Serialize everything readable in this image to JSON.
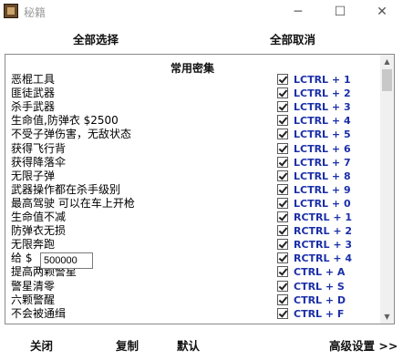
{
  "window": {
    "title": "秘籍",
    "minimize_glyph": "─",
    "maximize_glyph": "☐",
    "close_glyph": "✕",
    "icon": "app-icon"
  },
  "top_buttons": {
    "select_all": "全部选择",
    "deselect_all": "全部取消"
  },
  "section_title": "常用密集",
  "cheats": [
    {
      "label": "恶棍工具",
      "hotkey": "LCTRL + 1",
      "checked": true
    },
    {
      "label": "匪徒武器",
      "hotkey": "LCTRL + 2",
      "checked": true
    },
    {
      "label": "杀手武器",
      "hotkey": "LCTRL + 3",
      "checked": true
    },
    {
      "label": "生命值,防弹衣 $2500",
      "hotkey": "LCTRL + 4",
      "checked": true
    },
    {
      "label": "不受子弹伤害，无敌状态",
      "hotkey": "LCTRL + 5",
      "checked": true
    },
    {
      "label": "获得飞行背",
      "hotkey": "LCTRL + 6",
      "checked": true
    },
    {
      "label": "获得降落伞",
      "hotkey": "LCTRL + 7",
      "checked": true
    },
    {
      "label": "无限子弹",
      "hotkey": "LCTRL + 8",
      "checked": true
    },
    {
      "label": "武器操作都在杀手级别",
      "hotkey": "LCTRL + 9",
      "checked": true
    },
    {
      "label": "最高驾驶 可以在车上开枪",
      "hotkey": "LCTRL + 0",
      "checked": true
    },
    {
      "label": "生命值不减",
      "hotkey": "RCTRL + 1",
      "checked": true
    },
    {
      "label": "防弹衣无损",
      "hotkey": "RCTRL + 2",
      "checked": true
    },
    {
      "label": "无限奔跑",
      "hotkey": "RCTRL + 3",
      "checked": true
    },
    {
      "label": "给 $",
      "hotkey": "RCTRL + 4",
      "checked": true
    },
    {
      "label": "提高两颗警星",
      "hotkey": "CTRL + A",
      "checked": true
    },
    {
      "label": "警星清零",
      "hotkey": "CTRL + S",
      "checked": true
    },
    {
      "label": "六颗警醒",
      "hotkey": "CTRL + D",
      "checked": true
    },
    {
      "label": "不会被通缉",
      "hotkey": "CTRL + F",
      "checked": true
    }
  ],
  "money_input": {
    "value": "500000"
  },
  "scrollbar": {
    "up_glyph": "▲",
    "down_glyph": "▼"
  },
  "bottom_buttons": {
    "close": "关闭",
    "copy": "复制",
    "default": "默认",
    "advanced": "高级设置 >>"
  }
}
